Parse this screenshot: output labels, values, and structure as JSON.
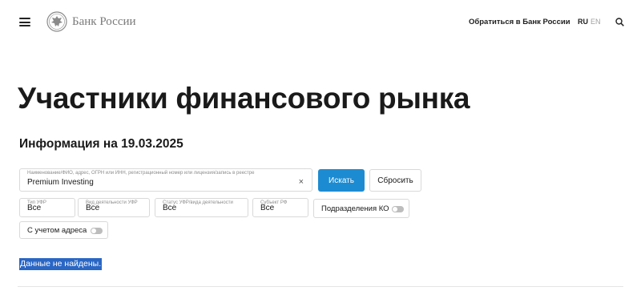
{
  "header": {
    "logo_text": "Банк России",
    "contact_link": "Обратиться в Банк России",
    "lang_ru": "RU",
    "lang_en": "EN"
  },
  "page": {
    "title": "Участники финансового рынка",
    "info_date": "Информация на 19.03.2025"
  },
  "search": {
    "query_label": "Наименование/ФИО, адрес, ОГРН или ИНН, регистрационный номер или лицензия/запись в реестре",
    "query_value": "Premium Investing",
    "clear_icon": "×",
    "search_button": "Искать",
    "reset_button": "Сбросить"
  },
  "filters": {
    "type_label": "Тип УФР",
    "type_value": "Все",
    "activity_label": "Вид деятельности УФР",
    "activity_value": "Все",
    "status_label": "Статус УФР/вида деятельности",
    "status_value": "Все",
    "subject_label": "Субъект РФ",
    "subject_value": "Все",
    "divisions_label": "Подразделения КО",
    "divisions_on": false,
    "address_label": "С учетом адреса",
    "address_on": false
  },
  "results": {
    "message": "Данные не найдены."
  },
  "colors": {
    "primary_button": "#1d8bd1",
    "selection_highlight": "#2a66c4",
    "border": "#d9d9d9"
  },
  "icons": [
    "menu-icon",
    "bank-of-russia-emblem",
    "search-icon",
    "clear-icon",
    "toggle-switch"
  ]
}
